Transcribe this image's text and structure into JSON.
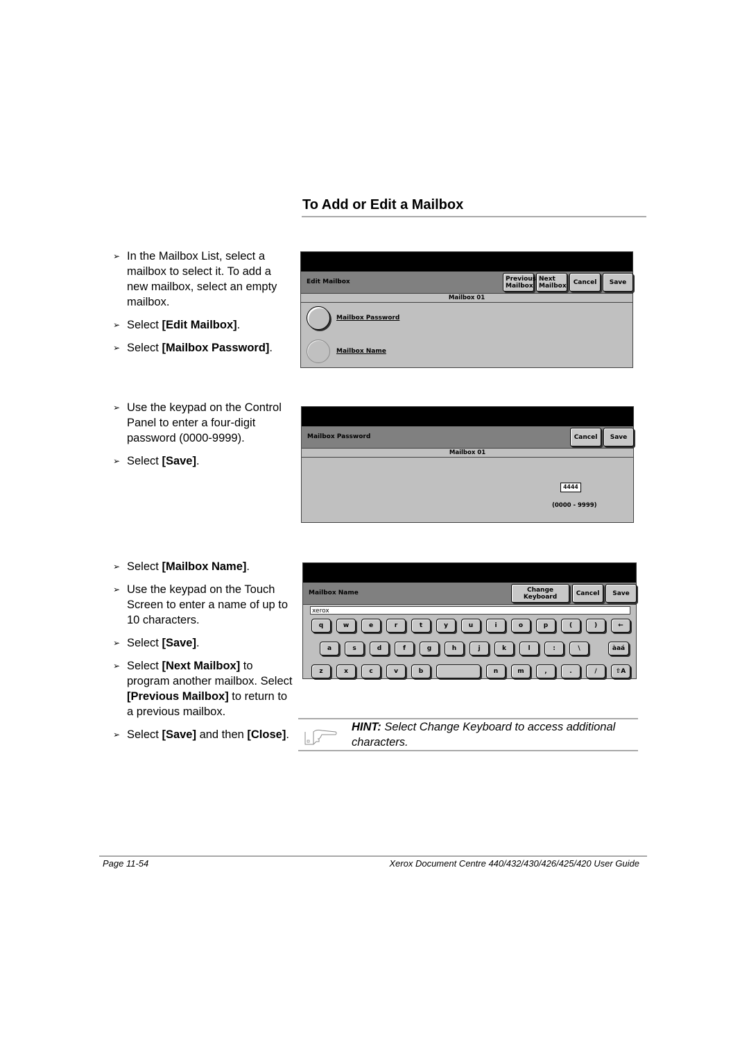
{
  "heading": "To Add or Edit a Mailbox",
  "steps_group1": [
    {
      "pre": "In the Mailbox List, select a mailbox to select it. To add a new mailbox, select an empty mailbox.",
      "bold": "",
      "post": ""
    },
    {
      "pre": "Select ",
      "bold": "[Edit Mailbox]",
      "post": "."
    },
    {
      "pre": "Select ",
      "bold": "[Mailbox Password]",
      "post": "."
    }
  ],
  "steps_group2": [
    {
      "pre": "Use the keypad on the Control Panel to enter a four-digit password (0000-9999).",
      "bold": "",
      "post": ""
    },
    {
      "pre": "Select ",
      "bold": "[Save]",
      "post": "."
    }
  ],
  "steps_group3": [
    {
      "pre": "Select ",
      "bold": "[Mailbox Name]",
      "post": "."
    },
    {
      "pre": "Use the keypad on the Touch Screen to enter a name of up to 10 characters.",
      "bold": "",
      "post": ""
    },
    {
      "pre": "Select ",
      "bold": "[Save]",
      "post": "."
    },
    {
      "pre": "Select ",
      "bold": "[Next Mailbox]",
      "post": " to program another mailbox. Select ",
      "bold2": "[Previous Mailbox]",
      "post2": " to return to a previous mailbox."
    },
    {
      "pre": "Select ",
      "bold": "[Save]",
      "post": " and then ",
      "bold2": "[Close]",
      "post2": "."
    }
  ],
  "bullet_glyph": "➢",
  "screen_edit": {
    "title": "Edit Mailbox",
    "buttons": {
      "previous_line1": "Previous",
      "previous_line2": "Mailbox",
      "next_line1": "Next",
      "next_line2": "Mailbox",
      "cancel": "Cancel",
      "save": "Save"
    },
    "subtitle": "Mailbox 01",
    "options": [
      {
        "label": "Mailbox Password",
        "selected": true
      },
      {
        "label": "Mailbox Name",
        "selected": false
      }
    ]
  },
  "screen_password": {
    "title": "Mailbox Password",
    "buttons": {
      "cancel": "Cancel",
      "save": "Save"
    },
    "subtitle": "Mailbox 01",
    "value": "4444",
    "range": "(0000 - 9999)"
  },
  "screen_name": {
    "title": "Mailbox Name",
    "buttons": {
      "change_keyboard": "Change Keyboard",
      "cancel": "Cancel",
      "save": "Save"
    },
    "value": "xerox",
    "keyboard": {
      "row1": [
        "q",
        "w",
        "e",
        "r",
        "t",
        "y",
        "u",
        "i",
        "o",
        "p",
        "(",
        ")",
        "←"
      ],
      "row2": [
        "a",
        "s",
        "d",
        "f",
        "g",
        "h",
        "j",
        "k",
        "l",
        ":",
        "\\",
        "àaá"
      ],
      "row3": [
        "z",
        "x",
        "c",
        "v",
        "b",
        " ",
        "n",
        "m",
        ",",
        ".",
        "/",
        "⇧A"
      ]
    }
  },
  "hint": {
    "label": "HINT:",
    "text": " Select Change Keyboard to access additional characters.",
    "icon": "pointing-hand-icon"
  },
  "footer": {
    "page": "Page 11-54",
    "guide": "Xerox Document Centre 440/432/430/426/425/420 User Guide"
  }
}
